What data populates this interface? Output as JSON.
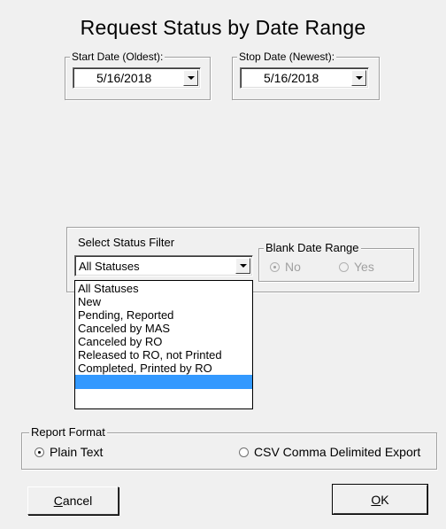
{
  "title": "Request Status by Date Range",
  "start_date": {
    "label": "Start Date (Oldest):",
    "value": "5/16/2018"
  },
  "stop_date": {
    "label": "Stop Date (Newest):",
    "value": "5/16/2018"
  },
  "status_filter": {
    "label": "Select Status Filter",
    "value": "All Statuses",
    "options": [
      "All Statuses",
      "New",
      "Pending, Reported",
      "Canceled by MAS",
      "Canceled by RO",
      "Released to RO, not Printed",
      "Completed, Printed by RO",
      ""
    ]
  },
  "blank_date_range": {
    "label": "Blank Date Range",
    "options": [
      {
        "label": "No",
        "checked": true
      },
      {
        "label": "Yes",
        "checked": false
      }
    ]
  },
  "report_format": {
    "label": "Report Format",
    "options": [
      {
        "label": "Plain Text",
        "checked": true
      },
      {
        "label": "CSV Comma Delimited Export",
        "checked": false
      }
    ]
  },
  "buttons": {
    "cancel": {
      "label": "Cancel",
      "mnemonic": "C",
      "rest": "ancel"
    },
    "ok": {
      "label": "OK",
      "mnemonic": "O",
      "rest": "K"
    }
  },
  "colors": {
    "selection": "#3399ff",
    "background": "#f0f0f0"
  }
}
